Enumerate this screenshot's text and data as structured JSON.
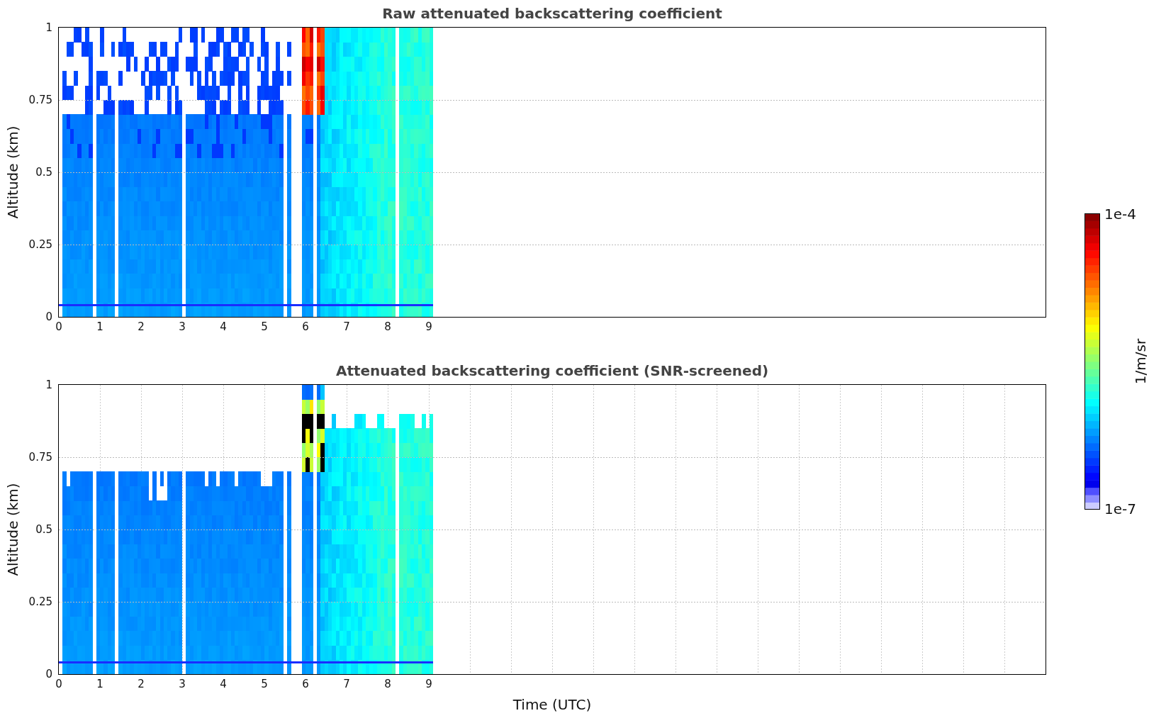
{
  "panels": [
    {
      "kind": "raw",
      "title": "Raw attenuated backscattering coefficient",
      "ylabel": "Altitude (km)",
      "yticks": [
        "1",
        "0.75",
        "0.5",
        "0.25",
        "0"
      ],
      "xticks": [
        "0",
        "1",
        "2",
        "3",
        "4",
        "5",
        "6",
        "7",
        "8",
        "9"
      ]
    },
    {
      "kind": "screened",
      "title": "Attenuated backscattering coefficient (SNR-screened)",
      "ylabel": "Altitude (km)",
      "yticks": [
        "1",
        "0.75",
        "0.5",
        "0.25",
        "0"
      ],
      "xticks": [
        "0",
        "1",
        "2",
        "3",
        "4",
        "5",
        "6",
        "7",
        "8",
        "9"
      ]
    }
  ],
  "xlabel": "Time (UTC)",
  "colorbar": {
    "max_label": "1e-4",
    "min_label": "1e-7",
    "label": "1/m/sr"
  }
}
